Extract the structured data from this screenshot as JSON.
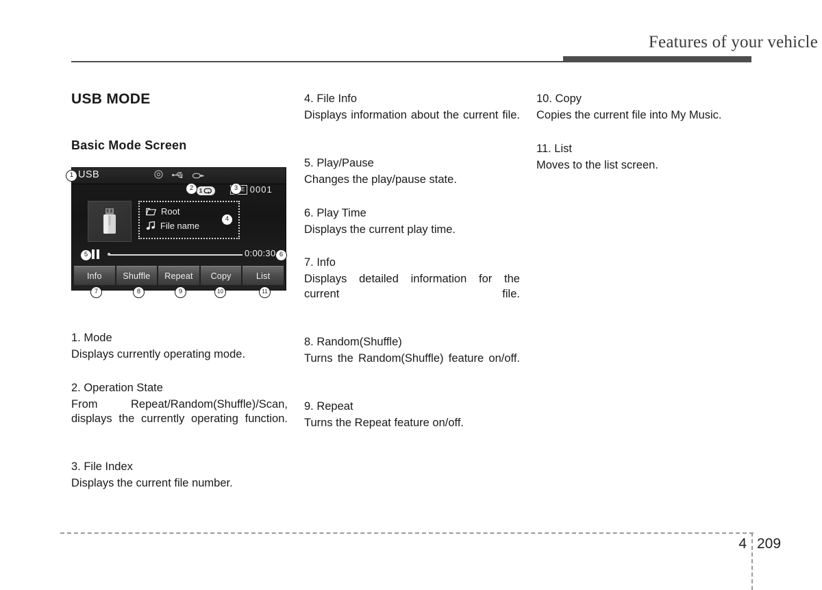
{
  "runhead": {
    "title": "Features of your vehicle"
  },
  "left_column": {
    "section_title": "USB MODE",
    "subsection_title": "Basic Mode Screen",
    "entries": [
      {
        "title": "1. Mode",
        "body": "Displays currently operating mode."
      },
      {
        "title": "2. Operation State",
        "body": "From Repeat/Random(Shuffle)/Scan, displays the currently operating function."
      },
      {
        "title": "3. File Index",
        "body": "Displays the current file number."
      }
    ]
  },
  "middle_column": {
    "entries": [
      {
        "title": "4. File Info",
        "body": "Displays information about the current file."
      },
      {
        "title": "5. Play/Pause",
        "body": "Changes the play/pause state."
      },
      {
        "title": "6. Play Time",
        "body": "Displays the current play time."
      },
      {
        "title": "7. Info",
        "body": "Displays detailed information for the current file."
      },
      {
        "title": "8. Random(Shuffle)",
        "body": "Turns the Random(Shuffle) feature on/off."
      },
      {
        "title": "9. Repeat",
        "body": "Turns the Repeat feature on/off."
      }
    ]
  },
  "right_column": {
    "entries": [
      {
        "title": "10. Copy",
        "body": "Copies the current file into My Music."
      },
      {
        "title": "11. List",
        "body": "Moves to the list screen."
      }
    ]
  },
  "device_screen": {
    "mode_label": "USB",
    "titlebar_icons": [
      "disc-icon",
      "usb-icon",
      "aux-plug-icon"
    ],
    "operation_state": {
      "repeat_count": "1",
      "icon": "repeat-loop-icon"
    },
    "file_index": {
      "tag": "FILE",
      "number": "0001"
    },
    "album_art_icon": "usb-flash-drive-icon",
    "file_info": {
      "folder_icon": "folder-icon",
      "folder_label": "Root",
      "track_icon": "music-note-icon",
      "track_label": "File name"
    },
    "playback": {
      "state_icon": "pause-icon",
      "play_time": "0:00:30"
    },
    "buttons": [
      "Info",
      "Shuffle",
      "Repeat",
      "Copy",
      "List"
    ],
    "callouts": {
      "c1": "①",
      "c2": "②",
      "c3": "③",
      "c4": "④",
      "c5": "⑤",
      "c6": "⑥",
      "c7": "⑦",
      "c8": "⑧",
      "c9": "⑨",
      "c10": "⑩",
      "c11": "⑪"
    },
    "callout_numbers": {
      "n1": "1",
      "n2": "2",
      "n3": "3",
      "n4": "4",
      "n5": "5",
      "n6": "6",
      "n7": "7",
      "n8": "8",
      "n9": "9",
      "n10": "10",
      "n11": "11"
    }
  },
  "footer": {
    "chapter": "4",
    "page": "209"
  },
  "colors": {
    "rule": "#4e4e4e",
    "screen_bg": "#1b1b1b",
    "button": "#4e4e4e",
    "text": "#1a1a1a"
  }
}
